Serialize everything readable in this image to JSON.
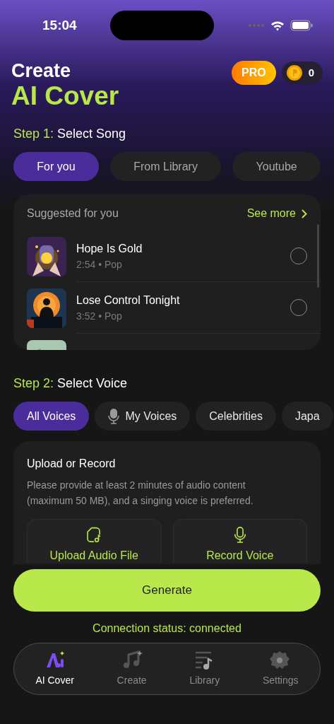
{
  "status_bar": {
    "time": "15:04"
  },
  "header": {
    "title": "Create",
    "subtitle": "AI Cover",
    "pro_badge": "PRO",
    "coins": "0"
  },
  "step1": {
    "label": "Step 1:",
    "title": "Select Song"
  },
  "song_tabs": [
    {
      "label": "For you",
      "selected": true
    },
    {
      "label": "From Library",
      "selected": false
    },
    {
      "label": "Youtube",
      "selected": false
    }
  ],
  "suggestions": {
    "title": "Suggested for you",
    "see_more": "See more",
    "songs": [
      {
        "kind": "song",
        "title": "Hope Is Gold",
        "meta": "2:54 • Pop",
        "selected": false
      },
      {
        "kind": "song",
        "title": "Lose Control Tonight",
        "meta": "3:52 • Pop",
        "selected": false
      },
      {
        "kind": "partial"
      }
    ]
  },
  "step2": {
    "label": "Step 2:",
    "title": "Select Voice"
  },
  "voice_tabs": [
    {
      "label": "All Voices",
      "selected": true,
      "kind": "plain"
    },
    {
      "label": "My Voices",
      "selected": false,
      "kind": "mic"
    },
    {
      "label": "Celebrities",
      "selected": false,
      "kind": "plain"
    },
    {
      "label": "Japa",
      "selected": false,
      "kind": "plain"
    }
  ],
  "upload": {
    "title": "Upload or Record",
    "description": "Please provide at least 2 minutes of audio content (maximum 50 MB), and a singing voice is preferred.",
    "buttons": [
      {
        "kind": "upload",
        "label": "Upload Audio File"
      },
      {
        "kind": "record",
        "label": "Record Voice"
      }
    ]
  },
  "generate": "Generate",
  "connection_status": "Connection status: connected",
  "nav": [
    {
      "kind": "ai",
      "label": "AI Cover",
      "selected": true
    },
    {
      "kind": "create",
      "label": "Create",
      "selected": false
    },
    {
      "kind": "library",
      "label": "Library",
      "selected": false
    },
    {
      "kind": "settings",
      "label": "Settings",
      "selected": false
    }
  ]
}
